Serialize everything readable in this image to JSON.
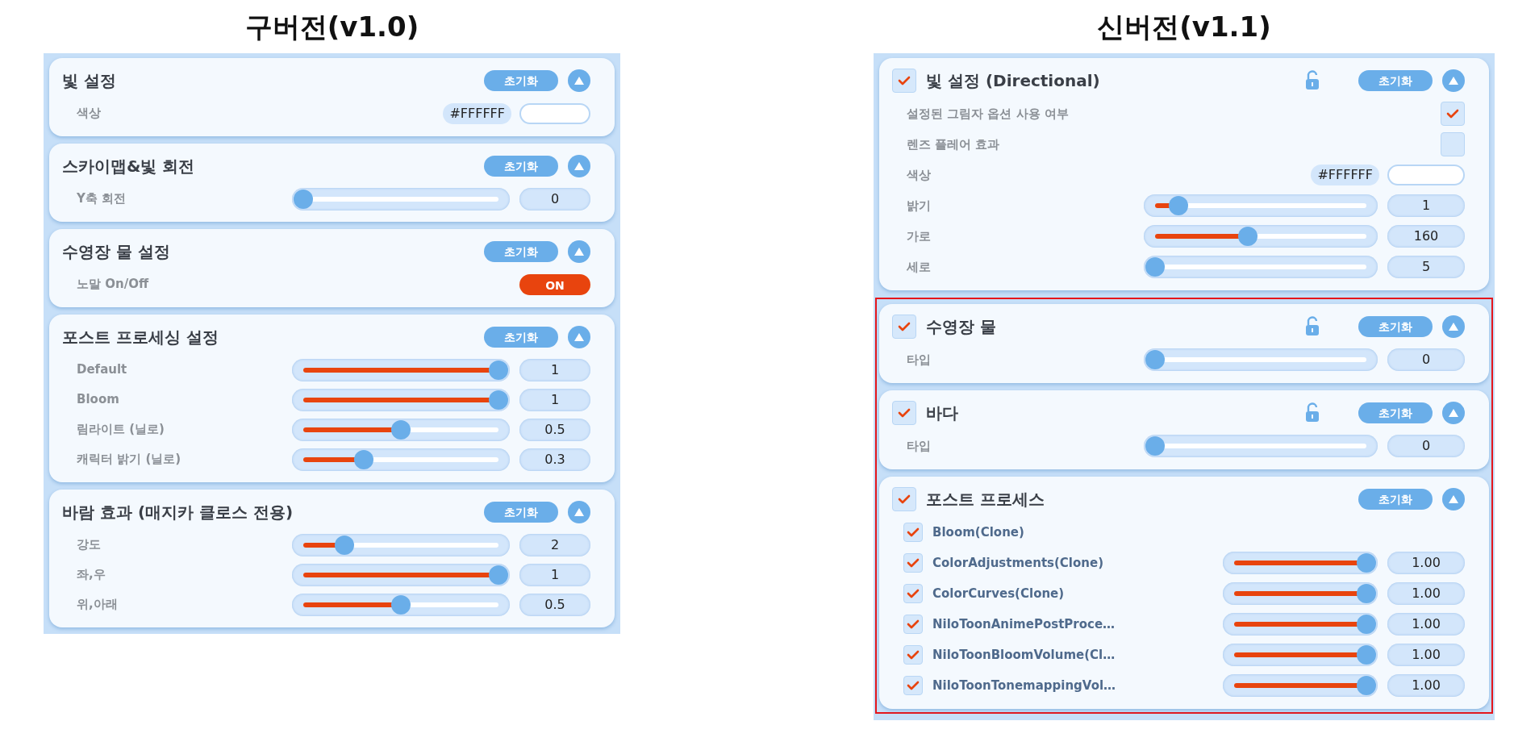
{
  "versions": [
    {
      "heading": "구버전(v1.0)",
      "sections": [
        {
          "title": "빛 설정",
          "reset_label": "초기화",
          "expanded": true,
          "highlighted": false,
          "rows": [
            {
              "kind": "color",
              "label": "색상",
              "value": "#FFFFFF"
            }
          ]
        },
        {
          "title": "스카이맵&빛 회전",
          "reset_label": "초기화",
          "expanded": true,
          "highlighted": false,
          "rows": [
            {
              "kind": "slider",
              "label": "Y축 회전",
              "level": 0,
              "value": "0"
            }
          ]
        },
        {
          "title": "수영장 물 설정",
          "reset_label": "초기화",
          "expanded": true,
          "highlighted": false,
          "rows": [
            {
              "kind": "toggle",
              "label": "노말 On/Off",
              "on": true,
              "text": "ON"
            }
          ]
        },
        {
          "title": "포스트 프로세싱 설정",
          "reset_label": "초기화",
          "expanded": true,
          "highlighted": false,
          "rows": [
            {
              "kind": "slider",
              "label": "Default",
              "level": 1,
              "value": "1"
            },
            {
              "kind": "slider",
              "label": "Bloom",
              "level": 1,
              "value": "1"
            },
            {
              "kind": "slider",
              "label": "림라이트 (닐로)",
              "level": 0.5,
              "value": "0.5"
            },
            {
              "kind": "slider",
              "label": "캐릭터 밝기 (닐로)",
              "level": 0.31,
              "value": "0.3"
            }
          ]
        },
        {
          "title": "바람 효과 (매지카 클로스 전용)",
          "reset_label": "초기화",
          "expanded": true,
          "highlighted": false,
          "rows": [
            {
              "kind": "slider",
              "label": "강도",
              "level": 0.21,
              "value": "2"
            },
            {
              "kind": "slider",
              "label": "좌,우",
              "level": 1,
              "value": "1"
            },
            {
              "kind": "slider",
              "label": "위,아래",
              "level": 0.5,
              "value": "0.5"
            }
          ]
        }
      ]
    },
    {
      "heading": "신버전(v1.1)",
      "sections": [
        {
          "title": "빛 설정 (Directional)",
          "checked": true,
          "lock": true,
          "reset_label": "초기화",
          "expanded": true,
          "highlighted": false,
          "rows": [
            {
              "kind": "checkbox",
              "label": "설정된 그림자 옵션 사용 여부",
              "checked": true
            },
            {
              "kind": "checkbox",
              "label": "렌즈 플레어 효과",
              "checked": false
            },
            {
              "kind": "color",
              "label": "색상",
              "value": "#FFFFFF"
            },
            {
              "kind": "slider",
              "label": "밝기",
              "level": 0.11,
              "value": "1"
            },
            {
              "kind": "slider",
              "label": "가로",
              "level": 0.44,
              "value": "160"
            },
            {
              "kind": "slider",
              "label": "세로",
              "level": 0,
              "value": "5"
            }
          ]
        },
        {
          "title": "수영장 물",
          "checked": true,
          "lock": true,
          "reset_label": "초기화",
          "expanded": true,
          "highlighted": true,
          "rows": [
            {
              "kind": "slider",
              "label": "타입",
              "level": 0,
              "value": "0"
            }
          ]
        },
        {
          "title": "바다",
          "checked": true,
          "lock": true,
          "reset_label": "초기화",
          "expanded": true,
          "highlighted": true,
          "rows": [
            {
              "kind": "slider",
              "label": "타입",
              "level": 0,
              "value": "0"
            }
          ]
        },
        {
          "title": "포스트 프로세스",
          "checked": true,
          "lock": false,
          "reset_label": "초기화",
          "expanded": true,
          "highlighted": true,
          "rows": [
            {
              "kind": "effect",
              "label": "Bloom(Clone)",
              "checked": true
            },
            {
              "kind": "effect",
              "label": "ColorAdjustments(Clone)",
              "checked": true,
              "level": 1,
              "value": "1.00"
            },
            {
              "kind": "effect",
              "label": "ColorCurves(Clone)",
              "checked": true,
              "level": 1,
              "value": "1.00"
            },
            {
              "kind": "effect",
              "label": "NiloToonAnimePostProce…",
              "checked": true,
              "level": 1,
              "value": "1.00"
            },
            {
              "kind": "effect",
              "label": "NiloToonBloomVolume(Cl…",
              "checked": true,
              "level": 1,
              "value": "1.00"
            },
            {
              "kind": "effect",
              "label": "NiloToonTonemappingVol…",
              "checked": true,
              "level": 1,
              "value": "1.00"
            }
          ]
        }
      ]
    }
  ]
}
